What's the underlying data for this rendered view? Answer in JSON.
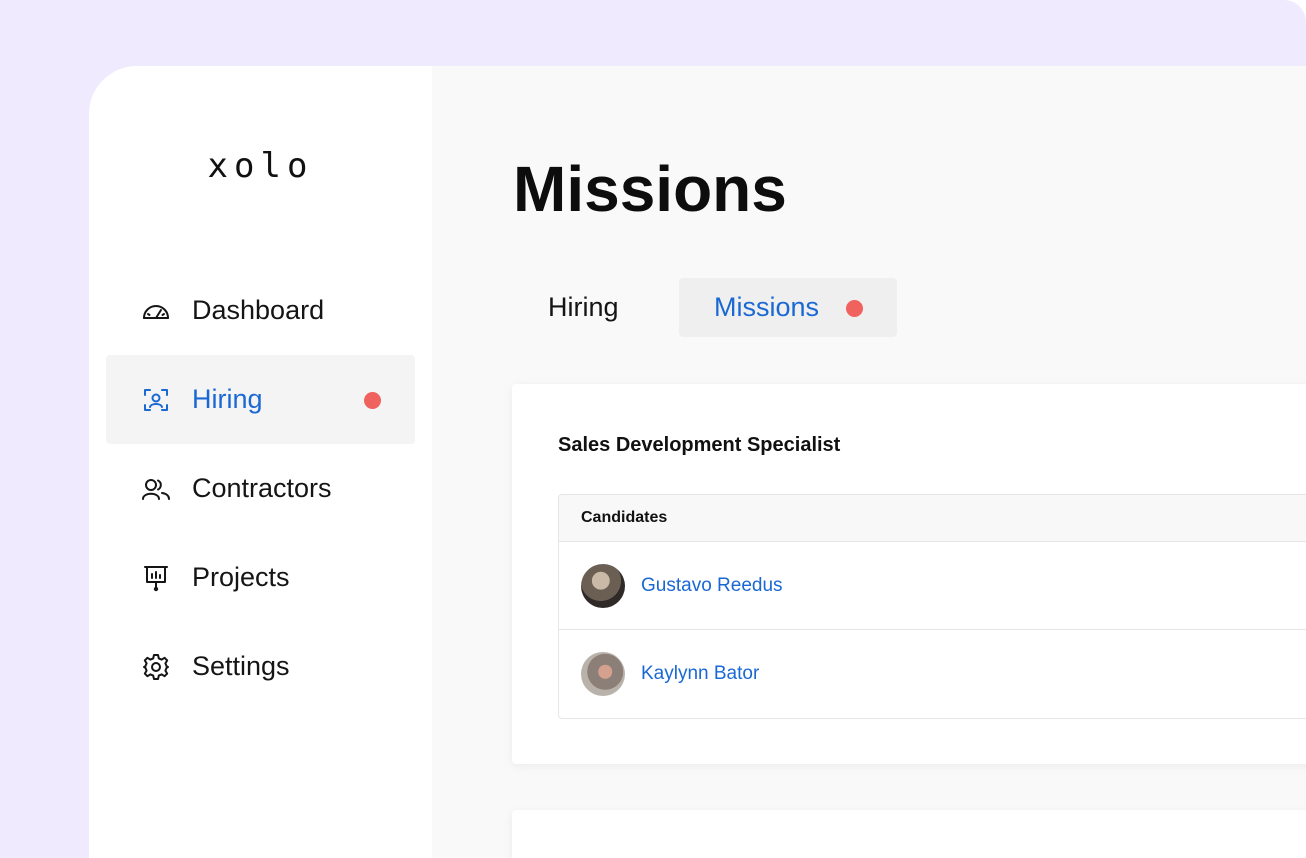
{
  "logo": {
    "text": "xolo"
  },
  "sidebar": {
    "items": [
      {
        "label": "Dashboard",
        "icon": "dashboard-gauge-icon"
      },
      {
        "label": "Hiring",
        "icon": "hiring-person-scan-icon",
        "active": true,
        "badge": "notification-dot"
      },
      {
        "label": "Contractors",
        "icon": "contractors-users-icon"
      },
      {
        "label": "Projects",
        "icon": "projects-presentation-icon"
      },
      {
        "label": "Settings",
        "icon": "settings-gear-icon"
      }
    ]
  },
  "main": {
    "title": "Missions",
    "tabs": [
      {
        "label": "Hiring"
      },
      {
        "label": "Missions",
        "active": true,
        "badge": "notification-dot"
      }
    ],
    "mission_card": {
      "title": "Sales Development Specialist",
      "table": {
        "header": "Candidates",
        "rows": [
          {
            "name": "Gustavo Reedus"
          },
          {
            "name": "Kaylynn Bator"
          }
        ]
      }
    }
  },
  "colors": {
    "backdrop": "#efeafd",
    "accent": "#1a68d4",
    "notification": "#f0625e",
    "text": "#151515"
  }
}
